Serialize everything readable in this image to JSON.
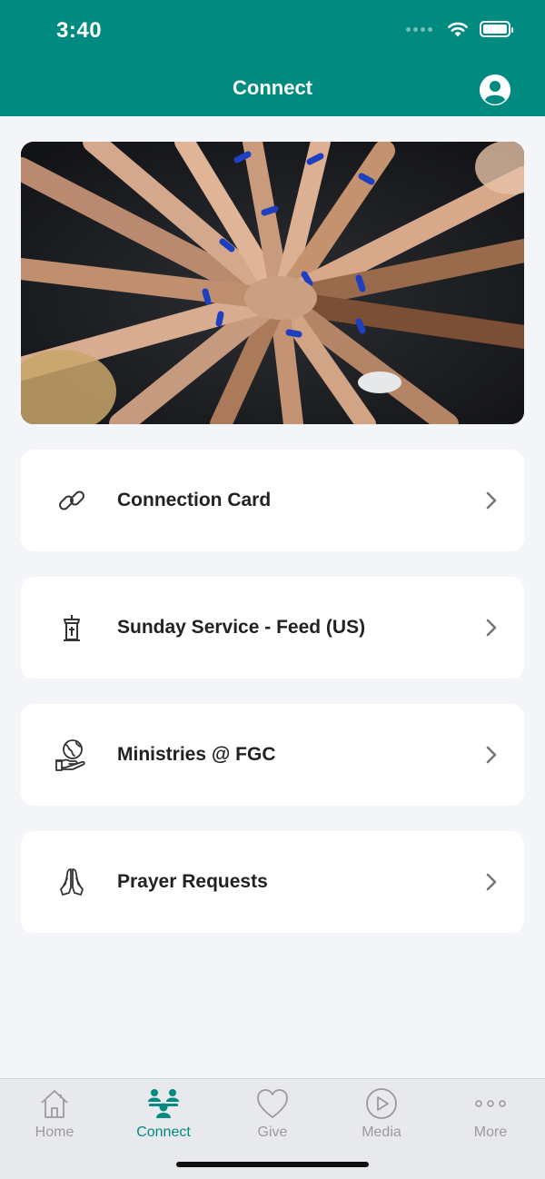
{
  "status_bar": {
    "time": "3:40"
  },
  "header": {
    "title": "Connect"
  },
  "hero": {
    "description": ""
  },
  "cards": [
    {
      "label": "Connection Card",
      "icon": "link-icon"
    },
    {
      "label": "Sunday Service - Feed (US)",
      "icon": "pulpit-icon"
    },
    {
      "label": "Ministries @ FGC",
      "icon": "globe-hand-icon"
    },
    {
      "label": "Prayer Requests",
      "icon": "praying-hands-icon"
    }
  ],
  "tabs": [
    {
      "label": "Home",
      "icon": "home-icon",
      "active": false
    },
    {
      "label": "Connect",
      "icon": "people-icon",
      "active": true
    },
    {
      "label": "Give",
      "icon": "heart-icon",
      "active": false
    },
    {
      "label": "Media",
      "icon": "play-icon",
      "active": false
    },
    {
      "label": "More",
      "icon": "more-icon",
      "active": false
    }
  ],
  "colors": {
    "brand": "#018a80",
    "background": "#f4f5f9",
    "tab_inactive": "#9a9aa0"
  }
}
